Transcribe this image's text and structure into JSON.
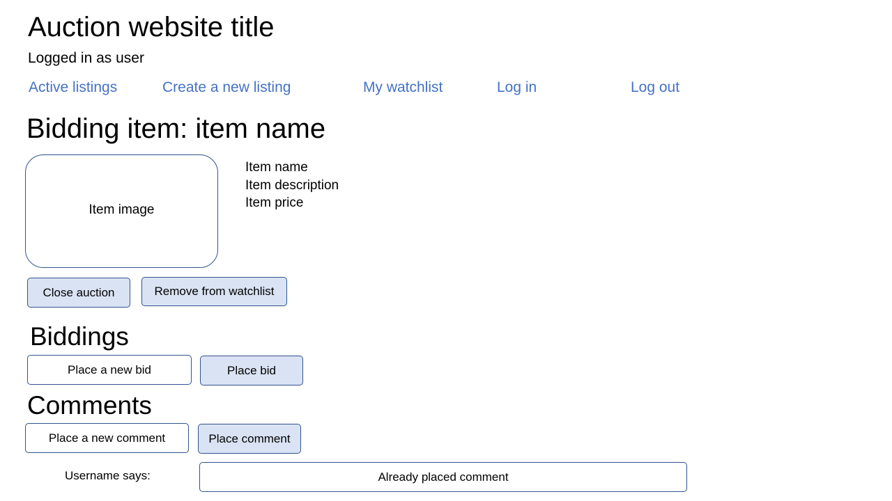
{
  "header": {
    "site_title": "Auction website title",
    "logged_in_text": "Logged in as user"
  },
  "nav": {
    "active_listings": "Active listings",
    "create_listing": "Create a new listing",
    "watchlist": "My watchlist",
    "log_in": "Log in",
    "log_out": "Log out"
  },
  "listing": {
    "heading": "Bidding item: item name",
    "image_label": "Item image",
    "name": "Item name",
    "description": "Item description",
    "price": "Item price",
    "close_button": "Close auction",
    "watchlist_button": "Remove from watchlist"
  },
  "biddings": {
    "heading": "Biddings",
    "bid_placeholder": "Place a new bid",
    "bid_button": "Place bid"
  },
  "comments": {
    "heading": "Comments",
    "comment_placeholder": "Place a new comment",
    "comment_button": "Place comment",
    "items": [
      {
        "author_label": "Username says:",
        "text": "Already placed comment"
      }
    ]
  },
  "colors": {
    "link": "#4472c4",
    "button_fill": "#dae3f3",
    "border": "#2f528f"
  }
}
